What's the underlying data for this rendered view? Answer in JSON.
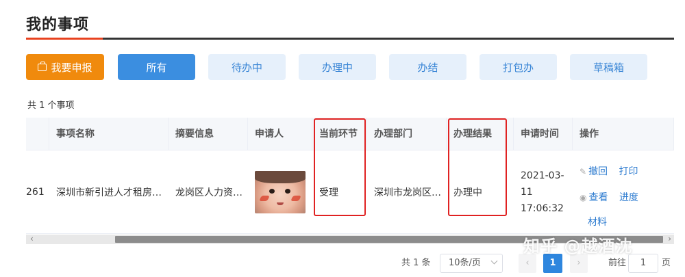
{
  "page": {
    "title": "我的事项"
  },
  "toolbar": {
    "apply_label": "我要申报",
    "filters": [
      "所有",
      "待办中",
      "办理中",
      "办结",
      "打包办",
      "草稿箱"
    ]
  },
  "summary": {
    "count_text": "共 1 个事项"
  },
  "table": {
    "headers": [
      "事项名称",
      "摘要信息",
      "申请人",
      "当前环节",
      "办理部门",
      "办理结果",
      "申请时间",
      "操作"
    ],
    "rows": [
      {
        "id_fragment": "261",
        "name": "深圳市新引进人才租房…",
        "summary": "龙岗区人力资…",
        "stage": "受理",
        "department": "深圳市龙岗区…",
        "result": "办理中",
        "time": "2021-03-11 17:06:32",
        "actions": [
          "撤回",
          "打印",
          "查看",
          "进度",
          "材料"
        ]
      }
    ]
  },
  "pagination": {
    "total_text": "共 1 条",
    "page_size": "10条/页",
    "current_page": "1",
    "goto_label": "前往",
    "goto_value": "1",
    "page_suffix": "页"
  },
  "watermark": "知乎 @越酒沈",
  "colors": {
    "accent_orange": "#f08a0d",
    "primary_blue": "#3b8ee0",
    "highlight_red": "#e02222"
  }
}
